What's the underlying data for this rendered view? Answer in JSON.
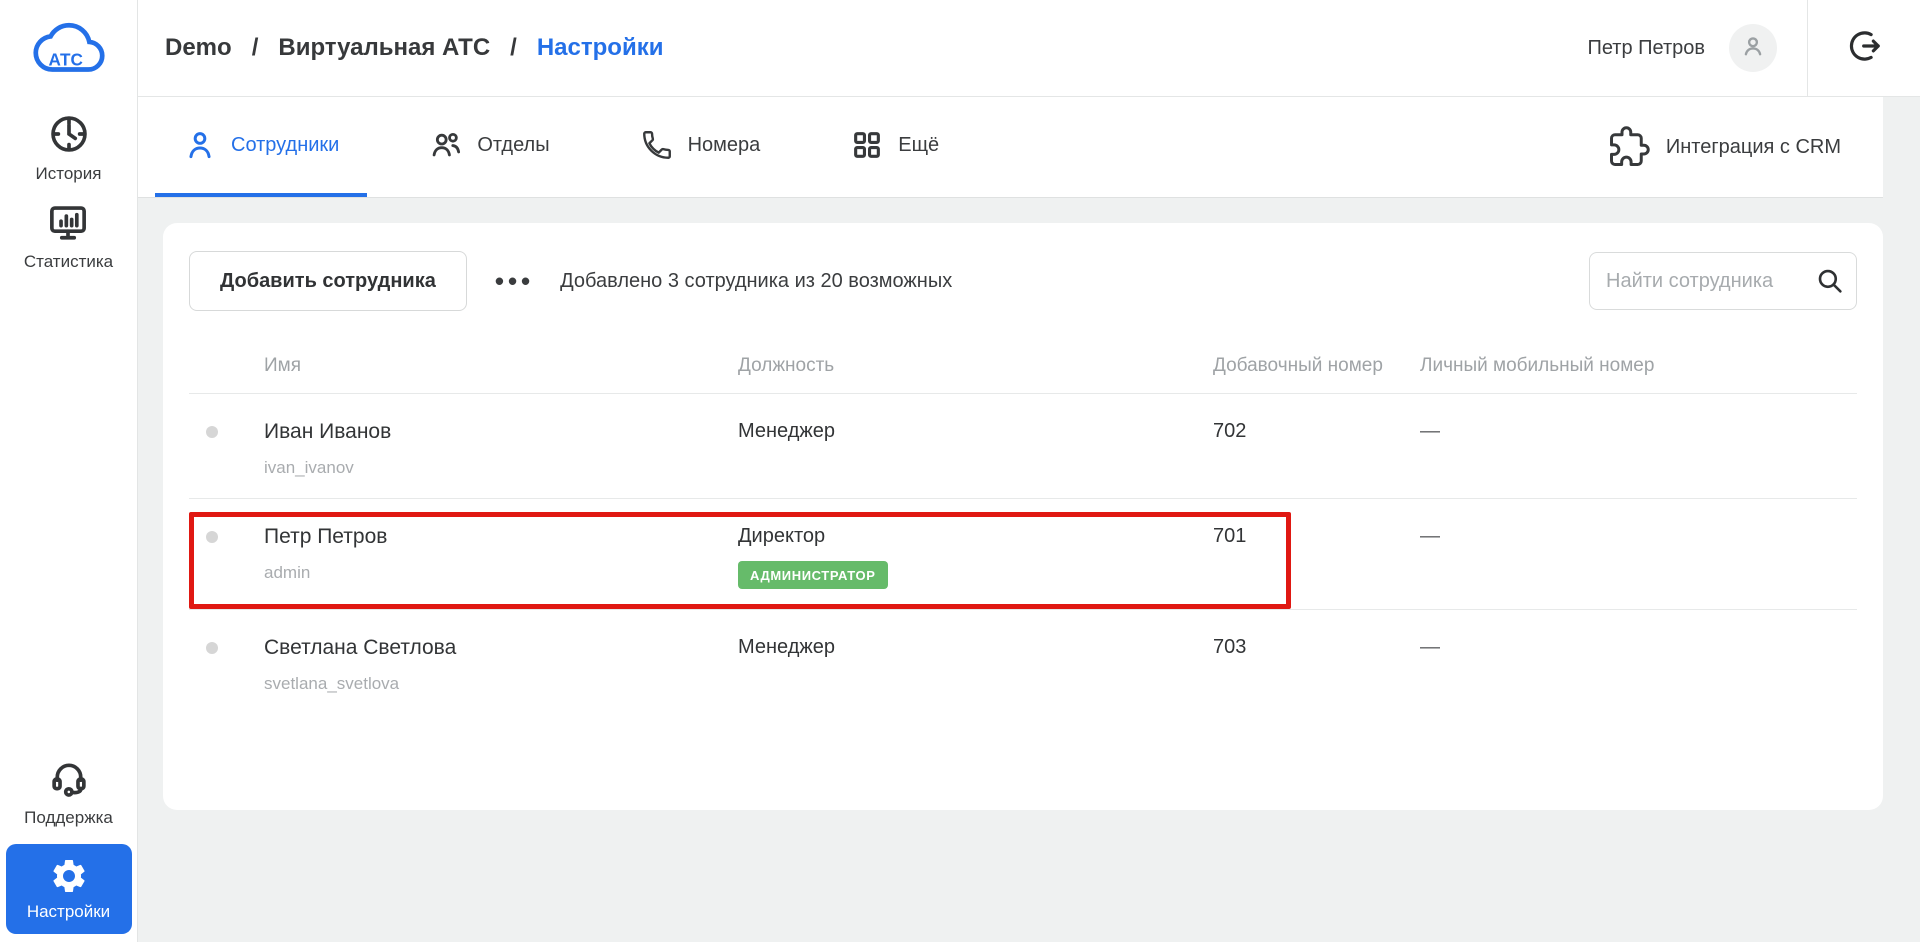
{
  "sidebar": {
    "logo_text": "АТС",
    "logo_icon": "cloud-atc-icon",
    "items": [
      {
        "label": "История",
        "icon": "clock-icon"
      },
      {
        "label": "Статистика",
        "icon": "statistics-monitor-icon"
      },
      {
        "label": "Поддержка",
        "icon": "headset-icon"
      },
      {
        "label": "Настройки",
        "icon": "gear-icon",
        "active": true
      }
    ]
  },
  "header": {
    "breadcrumb": [
      "Demo",
      "Виртуальная АТС",
      "Настройки"
    ],
    "separator": "/",
    "user_name": "Петр Петров",
    "icons": [
      "avatar-person-icon",
      "logout-icon"
    ]
  },
  "tabs": {
    "items": [
      {
        "label": "Сотрудники",
        "icon": "person-icon",
        "active": true
      },
      {
        "label": "Отделы",
        "icon": "people-icon"
      },
      {
        "label": "Номера",
        "icon": "phone-icon"
      },
      {
        "label": "Ещё",
        "icon": "grid-icon"
      }
    ],
    "crm_label": "Интеграция с CRM",
    "crm_icon": "puzzle-icon"
  },
  "toolbar": {
    "add_button": "Добавить сотрудника",
    "more_dots": "•••",
    "info": "Добавлено 3 сотрудника из 20 возможных",
    "search_placeholder": "Найти сотрудника",
    "search_value": "",
    "search_icon": "search-icon"
  },
  "table": {
    "columns": [
      "Имя",
      "Должность",
      "Добавочный номер",
      "Личный мобильный номер"
    ],
    "rows": [
      {
        "name": "Иван Иванов",
        "login": "ivan_ivanov",
        "role": "Менеджер",
        "badge": "",
        "ext": "702",
        "mobile": "—",
        "highlighted": false
      },
      {
        "name": "Петр Петров",
        "login": "admin",
        "role": "Директор",
        "badge": "АДМИНИСТРАТОР",
        "ext": "701",
        "mobile": "—",
        "highlighted": true
      },
      {
        "name": "Светлана Светлова",
        "login": "svetlana_svetlova",
        "role": "Менеджер",
        "badge": "",
        "ext": "703",
        "mobile": "—",
        "highlighted": false
      }
    ]
  },
  "colors": {
    "accent_blue": "#2470e8",
    "badge_green": "#66bb6a",
    "highlight_red": "#e01812",
    "page_background": "#eff1f1"
  }
}
